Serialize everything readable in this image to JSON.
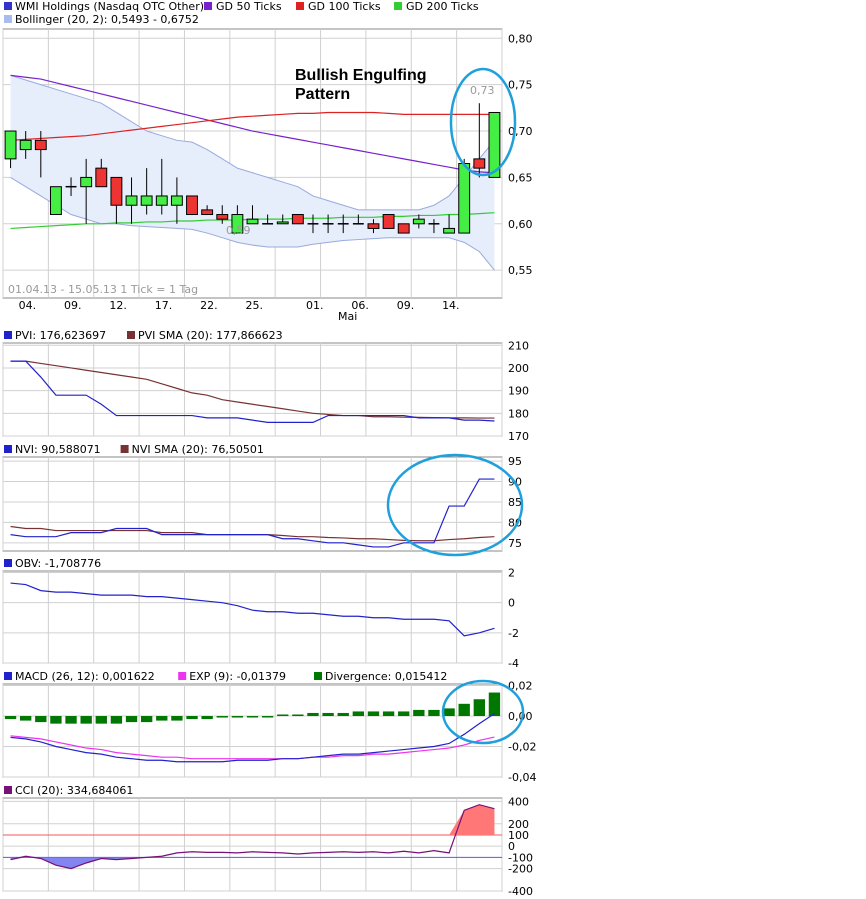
{
  "legend_main": {
    "items": [
      {
        "label": "WMI Holdings (Nasdaq OTC Other)",
        "color": "#3333cc"
      },
      {
        "label": "GD 50 Ticks",
        "color": "#7722cc"
      },
      {
        "label": "GD 100 Ticks",
        "color": "#dd2222"
      },
      {
        "label": "GD 200 Ticks",
        "color": "#33cc33"
      }
    ],
    "bollinger": {
      "label": "Bollinger (20, 2): 0,5493 - 0,6752",
      "color": "#aabbee"
    }
  },
  "annotation": {
    "line1": "Bullish Engulfing",
    "line2": "Pattern"
  },
  "range_text": "01.04.13 - 15.05.13   1 Tick = 1 Tag",
  "x_ticks": [
    "04.",
    "09.",
    "12.",
    "17.",
    "22.",
    "25.",
    "01.",
    "06.",
    "09.",
    "14."
  ],
  "x_month": "Mai",
  "labels_in_chart": {
    "high": "0,73",
    "low": "0,59"
  },
  "colors": {
    "up": "#44ee44",
    "down": "#ee3333",
    "blue": "#2222cc",
    "brown": "#773333",
    "purple": "#7722cc",
    "red": "#dd2222",
    "green": "#33cc33",
    "band": "#e6edfb",
    "band_line": "#99aadd",
    "circle": "#1fa0dd",
    "grid": "#d0d0d0",
    "macd_bar": "#007700",
    "exp": "#ee33ee",
    "cci_fill": "#ff7777",
    "cci_neg": "#7777ee"
  },
  "chart_data": [
    {
      "type": "candlestick",
      "title": "WMI Holdings (Nasdaq OTC Other)",
      "ylim": [
        0.52,
        0.81
      ],
      "y_ticks": [
        "0,80",
        "0,75",
        "0,70",
        "0,65",
        "0,60",
        "0,55"
      ],
      "candles": [
        {
          "o": 0.67,
          "h": 0.7,
          "l": 0.66,
          "c": 0.7
        },
        {
          "o": 0.68,
          "h": 0.7,
          "l": 0.67,
          "c": 0.69
        },
        {
          "o": 0.69,
          "h": 0.7,
          "l": 0.65,
          "c": 0.68
        },
        {
          "o": 0.61,
          "h": 0.64,
          "l": 0.61,
          "c": 0.64
        },
        {
          "o": 0.64,
          "h": 0.65,
          "l": 0.63,
          "c": 0.64
        },
        {
          "o": 0.64,
          "h": 0.67,
          "l": 0.6,
          "c": 0.65
        },
        {
          "o": 0.66,
          "h": 0.67,
          "l": 0.64,
          "c": 0.64
        },
        {
          "o": 0.65,
          "h": 0.65,
          "l": 0.6,
          "c": 0.62
        },
        {
          "o": 0.62,
          "h": 0.65,
          "l": 0.6,
          "c": 0.63
        },
        {
          "o": 0.62,
          "h": 0.66,
          "l": 0.61,
          "c": 0.63
        },
        {
          "o": 0.62,
          "h": 0.67,
          "l": 0.61,
          "c": 0.63
        },
        {
          "o": 0.62,
          "h": 0.65,
          "l": 0.6,
          "c": 0.63
        },
        {
          "o": 0.63,
          "h": 0.63,
          "l": 0.61,
          "c": 0.61
        },
        {
          "o": 0.615,
          "h": 0.62,
          "l": 0.61,
          "c": 0.61
        },
        {
          "o": 0.61,
          "h": 0.62,
          "l": 0.6,
          "c": 0.605
        },
        {
          "o": 0.59,
          "h": 0.62,
          "l": 0.59,
          "c": 0.61
        },
        {
          "o": 0.6,
          "h": 0.62,
          "l": 0.6,
          "c": 0.605
        },
        {
          "o": 0.6,
          "h": 0.61,
          "l": 0.6,
          "c": 0.6
        },
        {
          "o": 0.6,
          "h": 0.61,
          "l": 0.6,
          "c": 0.602
        },
        {
          "o": 0.61,
          "h": 0.61,
          "l": 0.6,
          "c": 0.6
        },
        {
          "o": 0.6,
          "h": 0.61,
          "l": 0.59,
          "c": 0.6
        },
        {
          "o": 0.6,
          "h": 0.61,
          "l": 0.59,
          "c": 0.6
        },
        {
          "o": 0.6,
          "h": 0.61,
          "l": 0.59,
          "c": 0.6
        },
        {
          "o": 0.6,
          "h": 0.61,
          "l": 0.6,
          "c": 0.6
        },
        {
          "o": 0.6,
          "h": 0.605,
          "l": 0.59,
          "c": 0.595
        },
        {
          "o": 0.61,
          "h": 0.61,
          "l": 0.595,
          "c": 0.595
        },
        {
          "o": 0.6,
          "h": 0.6,
          "l": 0.59,
          "c": 0.59
        },
        {
          "o": 0.6,
          "h": 0.61,
          "l": 0.595,
          "c": 0.605
        },
        {
          "o": 0.6,
          "h": 0.605,
          "l": 0.59,
          "c": 0.6
        },
        {
          "o": 0.59,
          "h": 0.61,
          "l": 0.59,
          "c": 0.595
        },
        {
          "o": 0.59,
          "h": 0.67,
          "l": 0.59,
          "c": 0.665
        },
        {
          "o": 0.67,
          "h": 0.73,
          "l": 0.65,
          "c": 0.66
        },
        {
          "o": 0.65,
          "h": 0.72,
          "l": 0.65,
          "c": 0.72
        }
      ],
      "bollinger_upper": [
        0.76,
        0.755,
        0.75,
        0.745,
        0.74,
        0.735,
        0.73,
        0.72,
        0.71,
        0.7,
        0.695,
        0.69,
        0.688,
        0.68,
        0.67,
        0.66,
        0.655,
        0.65,
        0.645,
        0.64,
        0.63,
        0.625,
        0.62,
        0.615,
        0.615,
        0.615,
        0.615,
        0.615,
        0.62,
        0.63,
        0.65,
        0.67,
        0.69
      ],
      "bollinger_lower": [
        0.65,
        0.64,
        0.63,
        0.62,
        0.61,
        0.605,
        0.6,
        0.6,
        0.598,
        0.597,
        0.596,
        0.595,
        0.594,
        0.59,
        0.585,
        0.58,
        0.577,
        0.575,
        0.575,
        0.575,
        0.578,
        0.58,
        0.582,
        0.583,
        0.584,
        0.585,
        0.585,
        0.585,
        0.585,
        0.585,
        0.58,
        0.57,
        0.55
      ],
      "gd50": [
        0.76,
        0.758,
        0.756,
        0.752,
        0.748,
        0.744,
        0.74,
        0.736,
        0.732,
        0.728,
        0.724,
        0.72,
        0.716,
        0.712,
        0.708,
        0.704,
        0.7,
        0.697,
        0.694,
        0.691,
        0.688,
        0.685,
        0.682,
        0.679,
        0.676,
        0.673,
        0.67,
        0.667,
        0.664,
        0.661,
        0.658,
        0.656,
        0.655
      ],
      "gd100": [
        0.69,
        0.691,
        0.692,
        0.693,
        0.694,
        0.695,
        0.697,
        0.699,
        0.701,
        0.703,
        0.705,
        0.707,
        0.709,
        0.711,
        0.713,
        0.715,
        0.716,
        0.717,
        0.718,
        0.719,
        0.719,
        0.72,
        0.72,
        0.72,
        0.72,
        0.719,
        0.718,
        0.718,
        0.718,
        0.718,
        0.718,
        0.718,
        0.718
      ],
      "gd200": [
        0.595,
        0.596,
        0.597,
        0.598,
        0.599,
        0.6,
        0.6,
        0.601,
        0.601,
        0.602,
        0.602,
        0.603,
        0.603,
        0.604,
        0.604,
        0.604,
        0.605,
        0.605,
        0.605,
        0.606,
        0.606,
        0.606,
        0.607,
        0.607,
        0.607,
        0.608,
        0.608,
        0.609,
        0.609,
        0.61,
        0.61,
        0.611,
        0.612
      ]
    },
    {
      "type": "line",
      "name": "PVI",
      "legend": [
        {
          "label": "PVI: 176,623697",
          "color": "#2222cc"
        },
        {
          "label": "PVI SMA (20): 177,866623",
          "color": "#773333"
        }
      ],
      "ylim": [
        170,
        211
      ],
      "y_ticks": [
        "210",
        "200",
        "190",
        "180",
        "170"
      ],
      "series": [
        {
          "name": "PVI",
          "values": [
            203,
            203,
            196,
            188,
            188,
            188,
            184,
            179,
            179,
            179,
            179,
            179,
            179,
            178,
            178,
            178,
            177,
            176,
            176,
            176,
            176,
            179,
            179,
            179,
            179,
            179,
            179,
            178,
            178,
            178,
            177,
            177,
            176.6
          ]
        },
        {
          "name": "PVI SMA (20)",
          "values": [
            203,
            203,
            202,
            201,
            200,
            199,
            198,
            197,
            196,
            195,
            193,
            191,
            189,
            188,
            186,
            185,
            184,
            183,
            182,
            181,
            180,
            179.5,
            179,
            179,
            178.5,
            178.5,
            178.3,
            178.2,
            178.1,
            178,
            178,
            177.9,
            177.9
          ]
        }
      ]
    },
    {
      "type": "line",
      "name": "NVI",
      "legend": [
        {
          "label": "NVI: 90,588071",
          "color": "#2222cc"
        },
        {
          "label": "NVI SMA (20): 76,50501",
          "color": "#773333"
        }
      ],
      "ylim": [
        73,
        96
      ],
      "y_ticks": [
        "95",
        "90",
        "85",
        "80",
        "75"
      ],
      "series": [
        {
          "name": "NVI",
          "values": [
            77,
            76.5,
            76.5,
            76.5,
            77.5,
            77.5,
            77.5,
            78.5,
            78.5,
            78.5,
            77,
            77,
            77,
            77,
            77,
            77,
            77,
            77,
            76,
            76,
            75.5,
            75,
            75,
            74.5,
            74,
            74,
            75,
            75,
            75,
            84,
            84,
            90.6,
            90.6
          ]
        },
        {
          "name": "NVI SMA (20)",
          "values": [
            79,
            78.5,
            78.5,
            78,
            78,
            78,
            78,
            78,
            78,
            78,
            77.5,
            77.5,
            77.5,
            77,
            77,
            77,
            77,
            77,
            76.8,
            76.5,
            76.5,
            76.3,
            76.2,
            76,
            76,
            75.8,
            75.6,
            75.5,
            75.5,
            75.8,
            76,
            76.3,
            76.5
          ]
        }
      ]
    },
    {
      "type": "line",
      "name": "OBV",
      "legend": [
        {
          "label": "OBV: -1,708776",
          "color": "#2222cc"
        }
      ],
      "ylim": [
        -4,
        2.1
      ],
      "y_ticks": [
        "2",
        "0",
        "-2",
        "-4"
      ],
      "series": [
        {
          "name": "OBV",
          "values": [
            1.3,
            1.2,
            0.8,
            0.7,
            0.7,
            0.6,
            0.5,
            0.5,
            0.5,
            0.4,
            0.4,
            0.3,
            0.2,
            0.1,
            0.0,
            -0.2,
            -0.5,
            -0.6,
            -0.6,
            -0.7,
            -0.7,
            -0.8,
            -0.9,
            -0.9,
            -1.0,
            -1.0,
            -1.1,
            -1.1,
            -1.1,
            -1.2,
            -2.2,
            -2.0,
            -1.7
          ]
        }
      ]
    },
    {
      "type": "bar_line",
      "name": "MACD",
      "legend": [
        {
          "label": "MACD (26, 12): 0,001622",
          "color": "#2222cc"
        },
        {
          "label": "EXP (9): -0,01379",
          "color": "#ee33ee"
        },
        {
          "label": "Divergence: 0,015412",
          "color": "#007700"
        }
      ],
      "ylim": [
        -0.04,
        0.021
      ],
      "y_ticks": [
        "0,02",
        "0,00",
        "-0,02",
        "-0,04"
      ],
      "series": [
        {
          "name": "MACD",
          "values": [
            -0.014,
            -0.015,
            -0.017,
            -0.02,
            -0.022,
            -0.024,
            -0.025,
            -0.027,
            -0.028,
            -0.029,
            -0.029,
            -0.03,
            -0.03,
            -0.03,
            -0.03,
            -0.029,
            -0.029,
            -0.029,
            -0.028,
            -0.028,
            -0.027,
            -0.026,
            -0.025,
            -0.025,
            -0.024,
            -0.023,
            -0.022,
            -0.021,
            -0.02,
            -0.018,
            -0.012,
            -0.005,
            0.0016
          ]
        },
        {
          "name": "EXP",
          "values": [
            -0.013,
            -0.014,
            -0.015,
            -0.017,
            -0.019,
            -0.021,
            -0.022,
            -0.024,
            -0.025,
            -0.026,
            -0.027,
            -0.027,
            -0.028,
            -0.028,
            -0.028,
            -0.028,
            -0.028,
            -0.028,
            -0.028,
            -0.028,
            -0.027,
            -0.027,
            -0.026,
            -0.026,
            -0.025,
            -0.025,
            -0.024,
            -0.023,
            -0.022,
            -0.021,
            -0.019,
            -0.016,
            -0.0138
          ]
        },
        {
          "name": "Divergence",
          "values": [
            -0.002,
            -0.003,
            -0.004,
            -0.005,
            -0.005,
            -0.005,
            -0.005,
            -0.005,
            -0.004,
            -0.004,
            -0.003,
            -0.003,
            -0.002,
            -0.002,
            -0.001,
            -0.001,
            0.0,
            0.0,
            0.001,
            0.001,
            0.002,
            0.002,
            0.002,
            0.003,
            0.003,
            0.003,
            0.003,
            0.004,
            0.004,
            0.005,
            0.008,
            0.011,
            0.0154
          ]
        }
      ]
    },
    {
      "type": "area",
      "name": "CCI",
      "legend": [
        {
          "label": "CCI (20): 334,684061",
          "color": "#771177"
        }
      ],
      "ylim": [
        -400,
        430
      ],
      "y_ticks": [
        "400",
        "200",
        "0",
        "-200",
        "-400"
      ],
      "ref_labels": [
        {
          "text": "100",
          "value": 100,
          "color": "#ff5555"
        },
        {
          "text": "-100",
          "value": -100,
          "color": "#5555ff"
        }
      ],
      "series": [
        {
          "name": "CCI",
          "values": [
            -120,
            -90,
            -110,
            -170,
            -200,
            -150,
            -110,
            -120,
            -110,
            -100,
            -90,
            -60,
            -50,
            -55,
            -55,
            -60,
            -50,
            -55,
            -60,
            -70,
            -60,
            -55,
            -50,
            -55,
            -50,
            -60,
            -45,
            -60,
            -40,
            -60,
            320,
            370,
            335
          ]
        }
      ]
    }
  ]
}
